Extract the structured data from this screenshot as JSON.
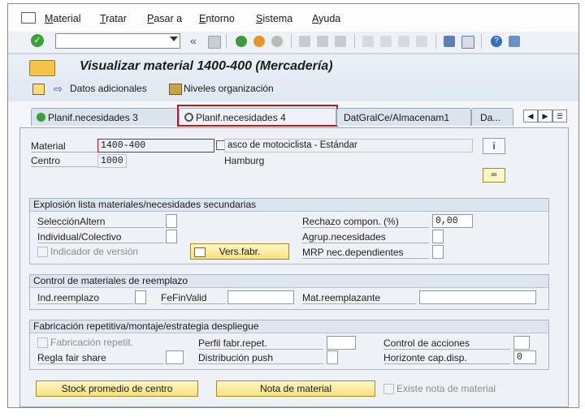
{
  "menu": [
    "Material",
    "Tratar",
    "Pasar a",
    "Entorno",
    "Sistema",
    "Ayuda"
  ],
  "title": "Visualizar material 1400-400 (Mercadería)",
  "app_toolbar": {
    "datos_adicionales": "Datos adicionales",
    "niveles_organizacion": "Niveles organización"
  },
  "tabs": [
    "Planif.necesidades 3",
    "Planif.necesidades 4",
    "DatGralCe/Almacenam1",
    "Da..."
  ],
  "header": {
    "material_label": "Material",
    "material_value": "1400-400",
    "material_desc": "asco de motociclista - Estándar",
    "centro_label": "Centro",
    "centro_value": "1000",
    "centro_desc": "Hamburg"
  },
  "group1": {
    "title": "Explosión lista materiales/necesidades secundarias",
    "seleccion": "SelecciónAltern",
    "individual": "Individual/Colectivo",
    "indicador_version": "Indicador de versión",
    "vers_fabr": "Vers.fabr.",
    "rechazo": "Rechazo compon. (%)",
    "rechazo_value": "0,00",
    "agrup": "Agrup.necesidades",
    "mrp": "MRP nec.dependientes"
  },
  "group2": {
    "title": "Control de materiales de reemplazo",
    "ind_reemplazo": "Ind.reemplazo",
    "fefinvalid": "FeFinValid",
    "mat_reemplazante": "Mat.reemplazante"
  },
  "group3": {
    "title": "Fabricación repetitiva/montaje/estrategia despliegue",
    "fabricacion_repetit": "Fabricación repetit.",
    "regla_fair_share": "Regla fair share",
    "perfil_fabr": "Perfil fabr.repet.",
    "distribucion_push": "Distribución push",
    "control_acciones": "Control de acciones",
    "horizonte": "Horizonte cap.disp.",
    "horizonte_value": "0"
  },
  "bottom": {
    "stock_promedio": "Stock promedio de centro",
    "nota_material": "Nota de material",
    "existe_nota": "Existe nota de material"
  },
  "colors": {
    "highlight": "#c0161c",
    "button_yellow": "#f7e27a"
  }
}
